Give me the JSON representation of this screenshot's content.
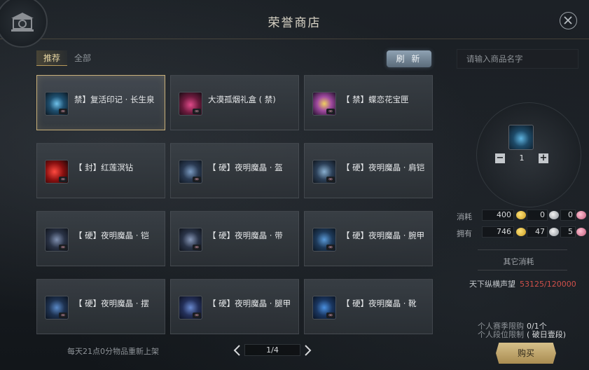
{
  "header": {
    "title": "荣誉商店"
  },
  "tabs": [
    {
      "label": "推荐",
      "active": true
    },
    {
      "label": "全部",
      "active": false
    }
  ],
  "refresh_label": "刷 新",
  "items": [
    {
      "name": "禁】复活印记 · 长生泉",
      "icon": "blue-mark-icon",
      "selected": true
    },
    {
      "name": "大漠孤烟礼盒 ( 禁)",
      "icon": "gift-box-icon"
    },
    {
      "name": "【 禁】蝶恋花宝匣",
      "icon": "butterfly-box-icon"
    },
    {
      "name": "【 封】红莲溟钻",
      "icon": "red-gem-icon"
    },
    {
      "name": "【 硬】夜明魔晶 · 盔",
      "icon": "helmet-icon"
    },
    {
      "name": "【 硬】夜明魔晶 · 肩铠",
      "icon": "shoulder-icon"
    },
    {
      "name": "【 硬】夜明魔晶 · 铠",
      "icon": "armor-icon"
    },
    {
      "name": "【 硬】夜明魔晶 · 带",
      "icon": "belt-icon"
    },
    {
      "name": "【 硬】夜明魔晶 · 腕甲",
      "icon": "bracer-icon"
    },
    {
      "name": "【 硬】夜明魔晶 · 摆",
      "icon": "skirt-icon"
    },
    {
      "name": "【 硬】夜明魔晶 · 腿甲",
      "icon": "leg-icon"
    },
    {
      "name": "【 硬】夜明魔晶 · 靴",
      "icon": "boots-icon"
    }
  ],
  "footer": {
    "restock_note": "每天21点0分物品重新上架",
    "page": "1/4"
  },
  "panel": {
    "search_placeholder": "请输入商品名字",
    "quantity": "1",
    "consume_label": "消耗",
    "own_label": "拥有",
    "consume": [
      "400",
      "0",
      "0"
    ],
    "own": [
      "746",
      "47",
      "5"
    ],
    "other_cost_label": "其它消耗",
    "prestige_label": "天下纵横声望",
    "prestige_value": "53125/120000",
    "season_limit_label": "个人赛季限购",
    "season_limit_value": "0/1个",
    "rank_limit_label": "个人段位限制",
    "rank_limit_value": "( 破日壹段)",
    "buy_label": "购买"
  },
  "colors": {
    "accent_gold": "#c8b07a",
    "prestige_red": "#d0504a"
  }
}
